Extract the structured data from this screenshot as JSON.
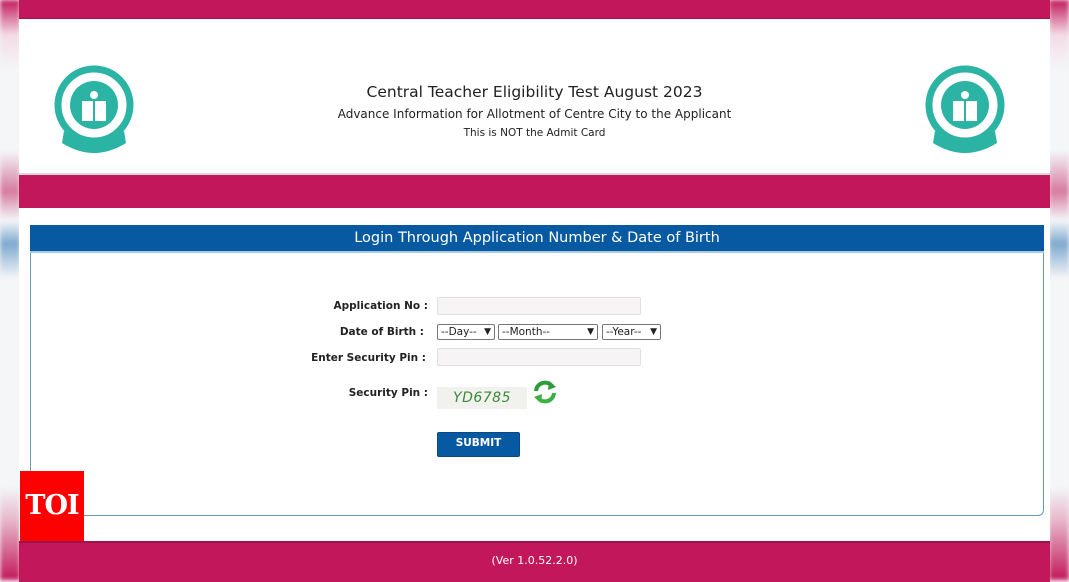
{
  "header": {
    "title": "Central Teacher Eligibility Test August 2023",
    "subtitle": "Advance Information for Allotment of Centre City to the Applicant",
    "note": "This is NOT the Admit Card",
    "logo_left": "cbse-emblem-logo",
    "logo_right": "cbse-emblem-logo"
  },
  "panel": {
    "heading": "Login Through Application Number & Date of Birth"
  },
  "form": {
    "application_no": {
      "label": "Application No :",
      "value": "",
      "placeholder": ""
    },
    "dob": {
      "label": "Date of Birth :",
      "day": "--Day--",
      "month": "--Month--",
      "year": "--Year--"
    },
    "security_pin_input": {
      "label": "Enter Security Pin :",
      "value": "",
      "placeholder": ""
    },
    "security_pin": {
      "label": "Security Pin :",
      "captcha": "YD6785",
      "refresh_icon": "refresh-icon"
    },
    "submit_label": "SUBMIT"
  },
  "footer": {
    "version": "(Ver 1.0.52.2.0)"
  },
  "watermark": {
    "text": "TOI"
  },
  "colors": {
    "brand": "#c2185b",
    "panel_header": "#075aa1",
    "captcha_text": "#3c8a3c"
  }
}
